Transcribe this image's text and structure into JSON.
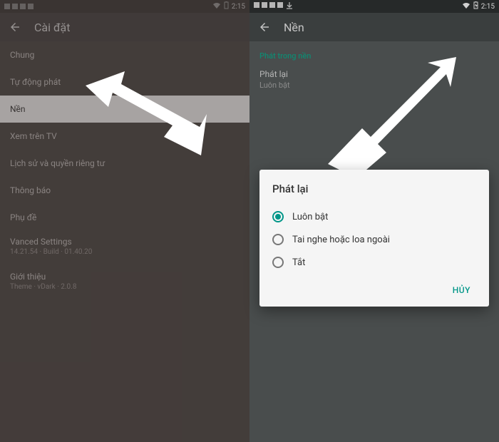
{
  "statusbar": {
    "time": "2:15"
  },
  "left": {
    "title": "Cài đặt",
    "items": [
      {
        "label": "Chung"
      },
      {
        "label": "Tự động phát"
      },
      {
        "label": "Nền",
        "highlight": true
      },
      {
        "label": "Xem trên TV"
      },
      {
        "label": "Lịch sử và quyền riêng tư"
      },
      {
        "label": "Thông báo"
      },
      {
        "label": "Phụ đề"
      },
      {
        "label": "Vanced Settings",
        "secondary": "14.21.54 · Build · 01.40.20"
      },
      {
        "label": "Giới thiệu",
        "secondary": "Theme · vDark · 2.0.8"
      }
    ]
  },
  "right": {
    "title": "Nền",
    "section": "Phát trong nền",
    "setting": {
      "label": "Phát lại",
      "value": "Luôn bật"
    }
  },
  "dialog": {
    "title": "Phát lại",
    "options": [
      {
        "label": "Luôn bật",
        "checked": true
      },
      {
        "label": "Tai nghe hoặc loa ngoài",
        "checked": false
      },
      {
        "label": "Tắt",
        "checked": false
      }
    ],
    "cancel": "HỦY"
  }
}
